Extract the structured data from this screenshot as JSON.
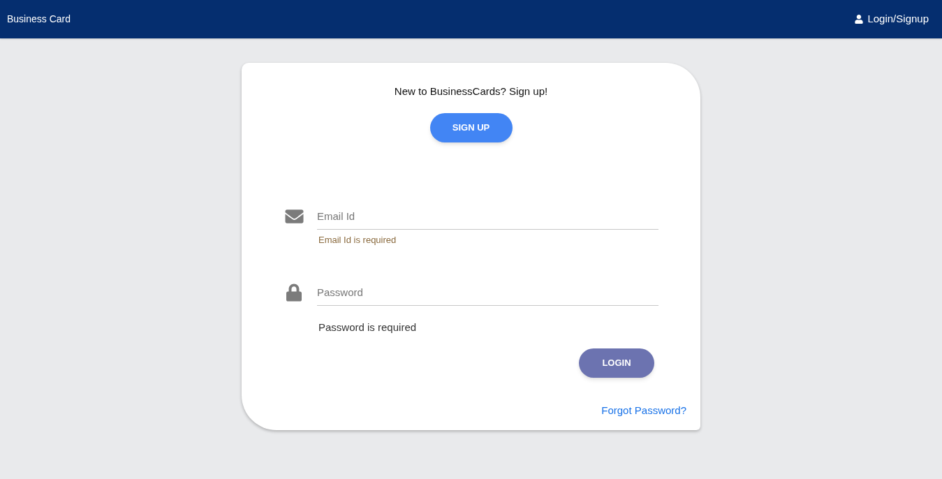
{
  "header": {
    "title": "Business Card",
    "login_link": "Login/Signup"
  },
  "card": {
    "prompt": "New to BusinessCards? Sign up!",
    "signup_button": "SIGN UP",
    "fields": [
      {
        "kind": "email",
        "placeholder": "Email Id",
        "error": "Email Id is required"
      },
      {
        "kind": "password",
        "placeholder": "Password",
        "error": "Password is required"
      }
    ],
    "login_button": "LOGIN",
    "forgot_link": "Forgot Password?"
  }
}
